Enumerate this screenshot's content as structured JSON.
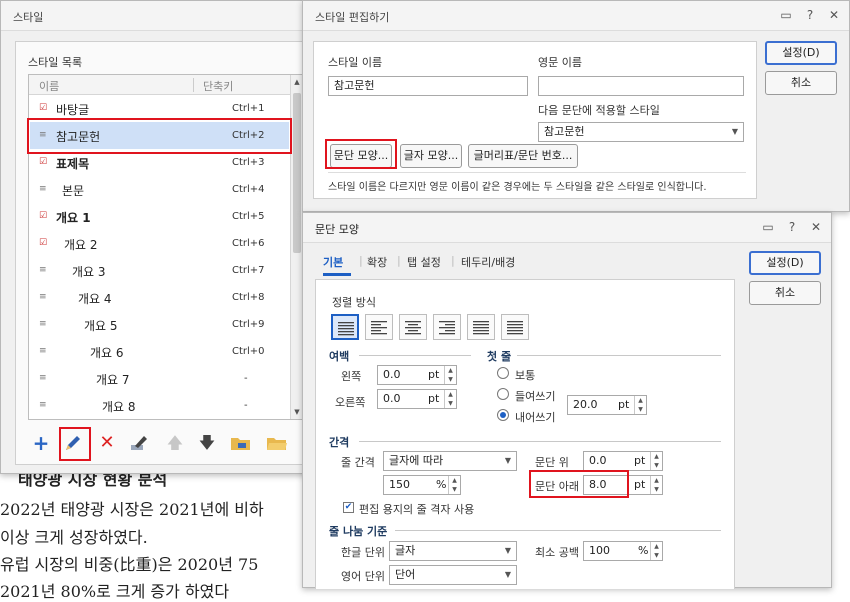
{
  "background_doc": {
    "lines": [
      "태양광 시장 현황 분석",
      "2022년 태양광 시장은 2021년에 비하",
      "이상 크게 성장하였다.",
      "유럽 시장의 비중(比重)은 2020년 75",
      "2021년 80%로 크게 증가 하였다"
    ]
  },
  "style_dialog": {
    "title": "스타일",
    "list_title": "스타일 목록",
    "col_name": "이름",
    "col_shortcut": "단축키",
    "items": [
      {
        "name": "바탕글",
        "key": "Ctrl+1",
        "icon": "paragraph-style-checked-icon",
        "bold": false,
        "indent": 0
      },
      {
        "name": "참고문헌",
        "key": "Ctrl+2",
        "icon": "paragraph-style-icon",
        "bold": false,
        "indent": 0
      },
      {
        "name": "표제목",
        "key": "Ctrl+3",
        "icon": "paragraph-style-checked-icon",
        "bold": true,
        "indent": 0
      },
      {
        "name": "본문",
        "key": "Ctrl+4",
        "icon": "paragraph-style-icon",
        "bold": false,
        "indent": 6
      },
      {
        "name": "개요 1",
        "key": "Ctrl+5",
        "icon": "paragraph-style-checked-icon",
        "bold": true,
        "indent": 0
      },
      {
        "name": "개요 2",
        "key": "Ctrl+6",
        "icon": "paragraph-style-checked-icon",
        "bold": false,
        "indent": 8
      },
      {
        "name": "개요 3",
        "key": "Ctrl+7",
        "icon": "paragraph-style-icon",
        "bold": false,
        "indent": 16
      },
      {
        "name": "개요 4",
        "key": "Ctrl+8",
        "icon": "paragraph-style-icon",
        "bold": false,
        "indent": 22
      },
      {
        "name": "개요 5",
        "key": "Ctrl+9",
        "icon": "paragraph-style-icon",
        "bold": false,
        "indent": 28
      },
      {
        "name": "개요 6",
        "key": "Ctrl+0",
        "icon": "paragraph-style-icon",
        "bold": false,
        "indent": 34
      },
      {
        "name": "개요 7",
        "key": "-",
        "icon": "paragraph-style-icon",
        "bold": false,
        "indent": 40
      },
      {
        "name": "개요 8",
        "key": "-",
        "icon": "paragraph-style-icon",
        "bold": false,
        "indent": 46
      }
    ],
    "selected_index": 1,
    "toolbar": [
      "add-icon",
      "edit-pencil-icon",
      "delete-icon",
      "edit-style-icon",
      "move-up-icon",
      "move-down-icon",
      "open-folder-style-icon",
      "open-folder-icon"
    ]
  },
  "edit_dialog": {
    "title": "스타일 편집하기",
    "style_name_label": "스타일 이름",
    "style_name_value": "참고문헌",
    "english_name_label": "영문 이름",
    "english_name_value": "",
    "next_style_label": "다음 문단에 적용할 스타일",
    "next_style_value": "참고문헌",
    "btn_paragraph": "문단 모양...",
    "btn_char": "글자 모양...",
    "btn_bullet": "글머리표/문단 번호...",
    "note": "스타일 이름은 다르지만 영문 이름이 같은 경우에는 두 스타일을 같은 스타일로 인식합니다.",
    "ok": "설정(D)",
    "cancel": "취소"
  },
  "para_dialog": {
    "title": "문단 모양",
    "tabs": [
      "기본",
      "확장",
      "탭 설정",
      "테두리/배경"
    ],
    "active_tab": 0,
    "ok": "설정(D)",
    "cancel": "취소",
    "align_label": "정렬 방식",
    "align_buttons": [
      "justify-align-icon",
      "left-align-icon",
      "center-align-icon",
      "right-align-icon",
      "distribute-align-icon",
      "split-align-icon"
    ],
    "margin_section": "여백",
    "left_label": "왼쪽",
    "left_value": "0.0",
    "right_label": "오른쪽",
    "right_value": "0.0",
    "unit_pt": "pt",
    "first_line_section": "첫 줄",
    "first_normal": "보통",
    "first_indent": "들여쓰기",
    "first_outdent": "내어쓰기",
    "first_value": "20.0",
    "first_selected": "내어쓰기",
    "spacing_section": "간격",
    "line_spacing_label": "줄 간격",
    "line_spacing_type": "글자에 따라",
    "line_spacing_value": "150",
    "unit_percent": "%",
    "above_label": "문단 위",
    "above_value": "0.0",
    "below_label": "문단 아래",
    "below_value": "8.0",
    "grid_checkbox": "편집 용지의 줄 격자 사용",
    "grid_checked": true,
    "linebreak_section": "줄 나눔 기준",
    "hangul_label": "한글 단위",
    "hangul_value": "글자",
    "min_space_label": "최소 공백",
    "min_space_value": "100",
    "english_label": "영어 단위",
    "english_value": "단어"
  }
}
